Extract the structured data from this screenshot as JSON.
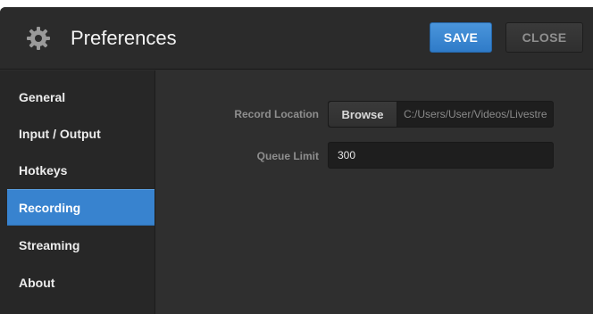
{
  "header": {
    "title": "Preferences",
    "icon": "gear-icon",
    "save_label": "SAVE",
    "close_label": "CLOSE"
  },
  "sidebar": {
    "items": [
      {
        "label": "General"
      },
      {
        "label": "Input / Output"
      },
      {
        "label": "Hotkeys"
      },
      {
        "label": "Recording",
        "active": true
      },
      {
        "label": "Streaming"
      },
      {
        "label": "About"
      }
    ]
  },
  "recording": {
    "record_location_label": "Record Location",
    "browse_label": "Browse",
    "record_location_value": "C:/Users/User/Videos/Livestre",
    "queue_limit_label": "Queue Limit",
    "queue_limit_value": "300"
  },
  "colors": {
    "accent": "#3883cf",
    "save_button": "#3a88d3",
    "background": "#2f2f2f",
    "sidebar": "#272727"
  }
}
